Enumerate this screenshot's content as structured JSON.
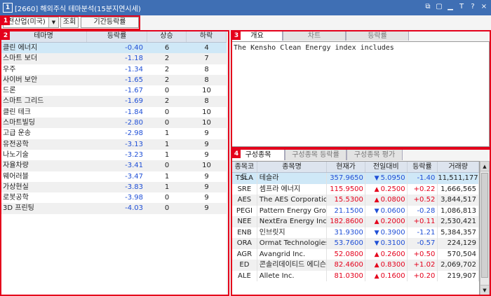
{
  "window": {
    "number": "1",
    "title": "[2660] 해외주식 테마분석(15분지연시세)"
  },
  "titlebar_icons": [
    "link-icon",
    "copy-icon",
    "minimize-icon",
    "font-icon",
    "help-icon",
    "close-icon"
  ],
  "titlebar_glyphs": [
    "⧉",
    "▢",
    "▁",
    "T",
    "?",
    "×"
  ],
  "toolbar": {
    "industry_select": "전산업(미국)",
    "query_label": "조회",
    "period_label": "기간등락률"
  },
  "badges": [
    "1",
    "2",
    "3",
    "4"
  ],
  "theme_table": {
    "headers": [
      "테마명",
      "등락률",
      "상승",
      "하락"
    ],
    "rows": [
      {
        "name": "클린 에너지",
        "rate": "-0.40",
        "up": "6",
        "down": "4"
      },
      {
        "name": "스마트 보더",
        "rate": "-1.18",
        "up": "2",
        "down": "7"
      },
      {
        "name": "우주",
        "rate": "-1.34",
        "up": "2",
        "down": "8"
      },
      {
        "name": "사이버 보안",
        "rate": "-1.65",
        "up": "2",
        "down": "8"
      },
      {
        "name": "드론",
        "rate": "-1.67",
        "up": "0",
        "down": "10"
      },
      {
        "name": "스마트 그리드",
        "rate": "-1.69",
        "up": "2",
        "down": "8"
      },
      {
        "name": "클린 테크",
        "rate": "-1.84",
        "up": "0",
        "down": "10"
      },
      {
        "name": "스마트빌딩",
        "rate": "-2.80",
        "up": "0",
        "down": "10"
      },
      {
        "name": "고급 운송",
        "rate": "-2.98",
        "up": "1",
        "down": "9"
      },
      {
        "name": "유전공학",
        "rate": "-3.13",
        "up": "1",
        "down": "9"
      },
      {
        "name": "나노기술",
        "rate": "-3.23",
        "up": "1",
        "down": "9"
      },
      {
        "name": "자율차량",
        "rate": "-3.41",
        "up": "0",
        "down": "10"
      },
      {
        "name": "웨어러블",
        "rate": "-3.47",
        "up": "1",
        "down": "9"
      },
      {
        "name": "가상현실",
        "rate": "-3.83",
        "up": "1",
        "down": "9"
      },
      {
        "name": "로봇공학",
        "rate": "-3.98",
        "up": "0",
        "down": "9"
      },
      {
        "name": "3D 프린팅",
        "rate": "-4.03",
        "up": "0",
        "down": "9"
      }
    ]
  },
  "detail_tabs": [
    "개요",
    "차트",
    "등락률"
  ],
  "overview_text": "The Kensho Clean Energy index includes",
  "component_tabs": [
    "구성종목",
    "구성종목 등락률",
    "구성종목 평가"
  ],
  "component_table": {
    "headers": [
      "종목코드",
      "종목명",
      "현재가",
      "전일대비",
      "등락률",
      "거래량"
    ],
    "rows": [
      {
        "code": "TSLA",
        "name": "테슬라",
        "price": "357.9650",
        "dir": "down",
        "change": "5.0950",
        "rate": "-1.40",
        "volume": "11,511,177"
      },
      {
        "code": "SRE",
        "name": "셈프라 에너지",
        "price": "115.9500",
        "dir": "up",
        "change": "0.2500",
        "rate": "+0.22",
        "volume": "1,666,565"
      },
      {
        "code": "AES",
        "name": "The AES Corporation",
        "price": "15.5300",
        "dir": "up",
        "change": "0.0800",
        "rate": "+0.52",
        "volume": "3,844,517"
      },
      {
        "code": "PEGI",
        "name": "Pattern Energy Group",
        "price": "21.1500",
        "dir": "down",
        "change": "0.0600",
        "rate": "-0.28",
        "volume": "1,086,813"
      },
      {
        "code": "NEE",
        "name": "NextEra Energy Inc.",
        "price": "182.8600",
        "dir": "up",
        "change": "0.2000",
        "rate": "+0.11",
        "volume": "2,530,421"
      },
      {
        "code": "ENB",
        "name": "인브릿지",
        "price": "31.9300",
        "dir": "down",
        "change": "0.3900",
        "rate": "-1.21",
        "volume": "5,384,357"
      },
      {
        "code": "ORA",
        "name": "Ormat Technologies I",
        "price": "53.7600",
        "dir": "down",
        "change": "0.3100",
        "rate": "-0.57",
        "volume": "224,129"
      },
      {
        "code": "AGR",
        "name": "Avangrid Inc.",
        "price": "52.0800",
        "dir": "up",
        "change": "0.2600",
        "rate": "+0.50",
        "volume": "570,504"
      },
      {
        "code": "ED",
        "name": "콘솔리데이티드 에디슨",
        "price": "82.4600",
        "dir": "up",
        "change": "0.8300",
        "rate": "+1.02",
        "volume": "2,069,702"
      },
      {
        "code": "ALE",
        "name": "Allete Inc.",
        "price": "81.0300",
        "dir": "up",
        "change": "0.1600",
        "rate": "+0.20",
        "volume": "219,907"
      }
    ]
  },
  "colors": {
    "titlebar": "#3f6fb4",
    "highlight_box": "#e4001b",
    "up": "#e4001b",
    "down": "#1f4fd6",
    "selected_row": "#cfe8f7"
  }
}
